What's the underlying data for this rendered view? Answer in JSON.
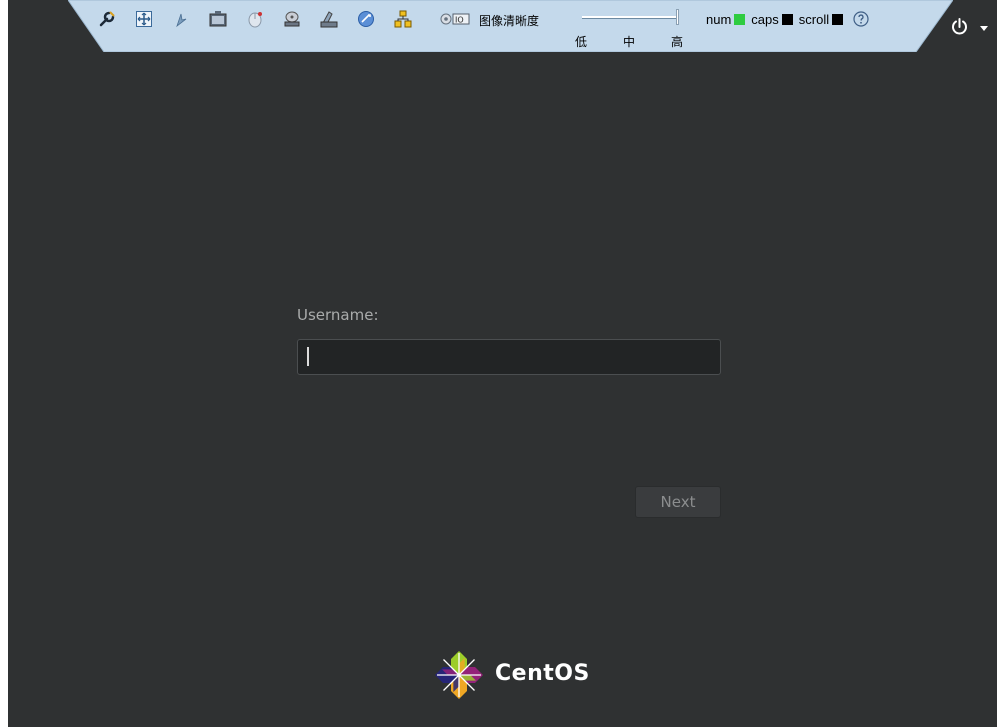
{
  "kvm_toolbar": {
    "icons": [
      "tools-icon",
      "move-icon",
      "mouse-pointer-icon",
      "screenshot-icon",
      "mouse-icon",
      "virtual-drive-icon",
      "keyboard-icon",
      "macro-icon",
      "network-icon",
      "display-settings-icon"
    ],
    "clarity_label": "图像清晰度",
    "clarity_levels": {
      "low": "低",
      "mid": "中",
      "high": "高"
    },
    "clarity_value": "高",
    "indicators": {
      "num_label": "num",
      "num_color": "#2ecc40",
      "caps_label": "caps",
      "caps_color": "#000000",
      "scroll_label": "scroll",
      "scroll_color": "#000000"
    },
    "help_icon": "help-icon",
    "toolbar_color": "#c4d9eb"
  },
  "top_bar": {
    "power_icon": "power-icon",
    "menu_icon": "chevron-down-icon"
  },
  "login": {
    "username_label": "Username:",
    "username_value": "",
    "next_label": "Next"
  },
  "branding": {
    "logo_text": "CentOS"
  }
}
